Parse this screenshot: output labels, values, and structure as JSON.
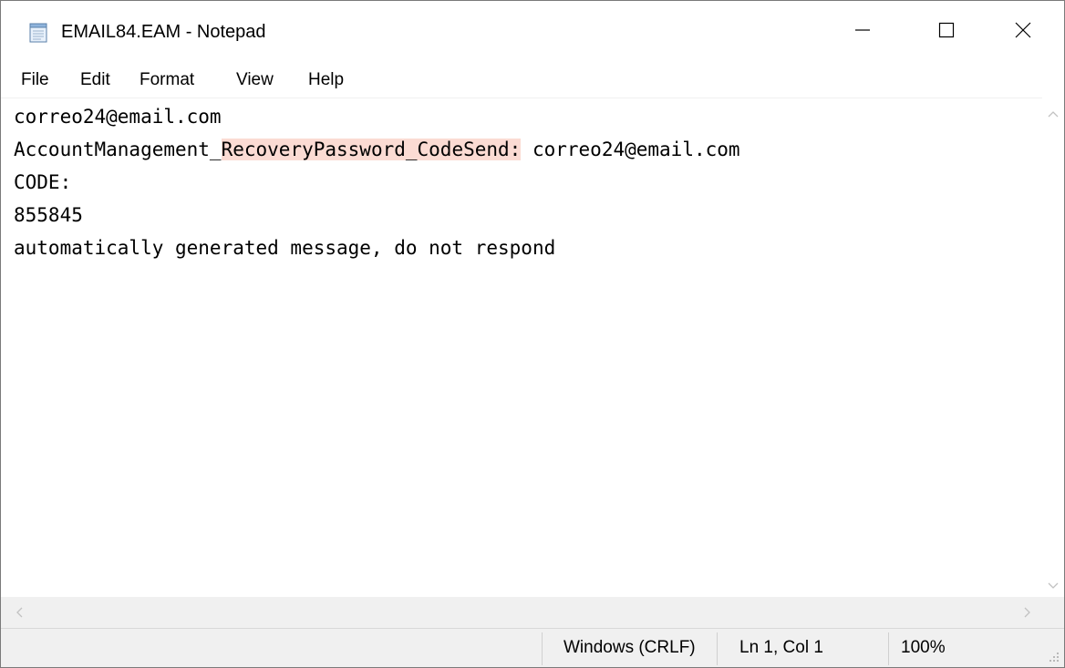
{
  "window": {
    "title": "EMAIL84.EAM - Notepad",
    "app_icon": "notepad-icon"
  },
  "title_buttons": {
    "minimize_icon": "minimize-icon",
    "maximize_icon": "maximize-icon",
    "close_icon": "close-icon"
  },
  "menu": {
    "items": [
      {
        "label": "File"
      },
      {
        "label": "Edit"
      },
      {
        "label": "Format"
      },
      {
        "label": "View"
      },
      {
        "label": "Help"
      }
    ]
  },
  "document": {
    "lines": [
      {
        "text": "correo24@email.com"
      },
      {
        "before": "AccountManagement_",
        "highlight": "RecoveryPassword_CodeSend:",
        "after": " correo24@email.com"
      },
      {
        "text": "CODE:"
      },
      {
        "text": "855845"
      },
      {
        "text": "automatically generated message, do not respond"
      }
    ],
    "highlight_color": "#fbdbd3"
  },
  "status": {
    "line_ending": "Windows (CRLF)",
    "position": "Ln 1, Col 1",
    "zoom": "100%"
  },
  "colors": {
    "chrome_bg": "#f0f0f0",
    "border": "#7a7a7a"
  }
}
